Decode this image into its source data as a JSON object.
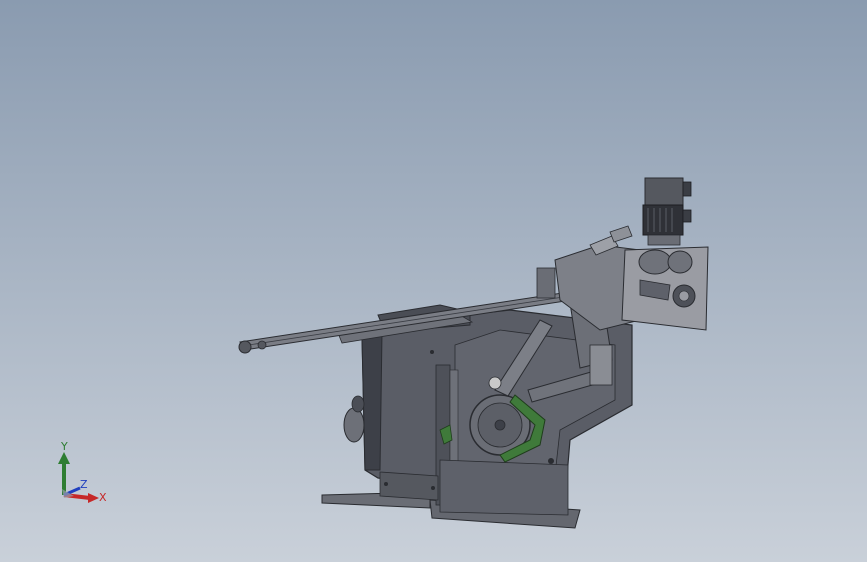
{
  "viewport": {
    "background_top": "#8a9bb0",
    "background_bottom": "#c9d0d9"
  },
  "model": {
    "body_color": "#5a5d66",
    "body_dark": "#3d4048",
    "edge_color": "#2a2c31",
    "accent_green": "#3f7a3a"
  },
  "triad": {
    "x_label": "X",
    "y_label": "Y",
    "z_label": "Z",
    "x_color": "#c62828",
    "y_color": "#2e7d32",
    "z_color": "#1f3fbf"
  }
}
